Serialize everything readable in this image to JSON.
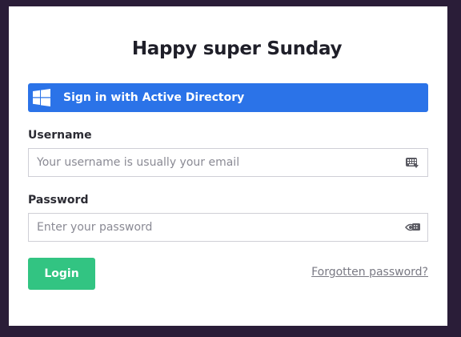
{
  "title": "Happy super Sunday",
  "ad_button": {
    "label": "Sign in with Active Directory",
    "icon": "windows-logo-icon",
    "color": "#2b73e8"
  },
  "username": {
    "label": "Username",
    "placeholder": "Your username is usually your email",
    "value": "",
    "icon": "keyboard-icon"
  },
  "password": {
    "label": "Password",
    "placeholder": "Enter your password",
    "value": "",
    "icon": "keyboard-icon"
  },
  "login": {
    "label": "Login",
    "color": "#32c482"
  },
  "forgot": {
    "label": "Forgotten password?"
  }
}
